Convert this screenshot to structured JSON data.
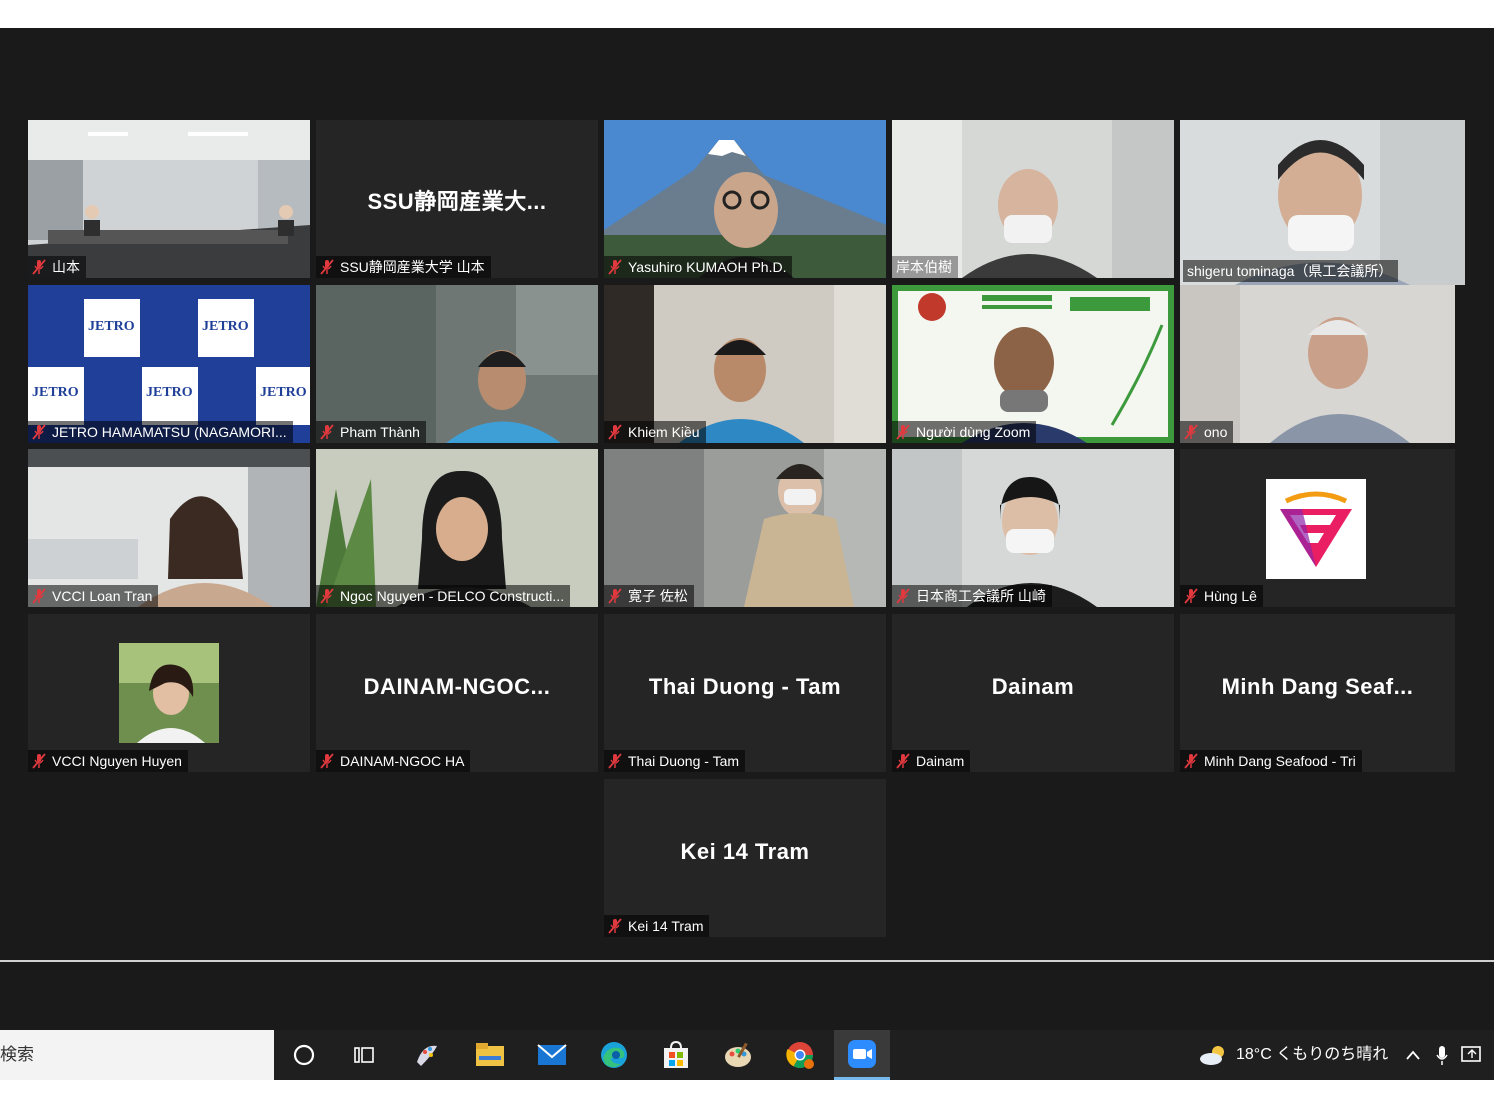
{
  "meeting": {
    "tiles": [
      {
        "label": "山本",
        "big": ""
      },
      {
        "label": "SSU静岡産業大学 山本",
        "big": "SSU静岡産業大..."
      },
      {
        "label": "Yasuhiro KUMAOH Ph.D.",
        "big": ""
      },
      {
        "label": "岸本伯樹",
        "big": ""
      },
      {
        "label": "shigeru tominaga（県工会議所）",
        "big": ""
      },
      {
        "label": "JETRO HAMAMATSU (NAGAMORI...",
        "big": ""
      },
      {
        "label": "Pham Thành",
        "big": ""
      },
      {
        "label": "Khiem Kiều",
        "big": ""
      },
      {
        "label": "Người dùng Zoom",
        "big": ""
      },
      {
        "label": "ono",
        "big": ""
      },
      {
        "label": "VCCI Loan Tran",
        "big": ""
      },
      {
        "label": "Ngoc Nguyen - DELCO Constructi...",
        "big": ""
      },
      {
        "label": "寛子 佐松",
        "big": ""
      },
      {
        "label": "日本商工会議所 山崎",
        "big": ""
      },
      {
        "label": "Hùng Lê",
        "big": ""
      },
      {
        "label": "VCCI Nguyen Huyen",
        "big": ""
      },
      {
        "label": "DAINAM-NGOC HA",
        "big": "DAINAM-NGOC..."
      },
      {
        "label": "Thai Duong - Tam",
        "big": "Thai Duong - Tam"
      },
      {
        "label": "Dainam",
        "big": "Dainam"
      },
      {
        "label": "Minh Dang Seafood - Tri",
        "big": "Minh Dang Seaf..."
      },
      {
        "label": "Kei 14 Tram",
        "big": "Kei 14 Tram"
      }
    ],
    "backdrop_text": [
      "JETRO",
      "JETRO",
      "JETRO",
      "JETRO",
      "JETRO"
    ],
    "accent_color": "#b6dc45",
    "muted_mic_color": "#e0393e"
  },
  "taskbar": {
    "search_label": "検索",
    "weather": "18°C くもりのち晴れ",
    "icons": [
      "cortana-icon",
      "task-view-icon",
      "paint-icon",
      "file-explorer-icon",
      "mail-icon",
      "edge-icon",
      "store-icon",
      "paint3d-icon",
      "chrome-icon",
      "zoom-icon"
    ]
  }
}
